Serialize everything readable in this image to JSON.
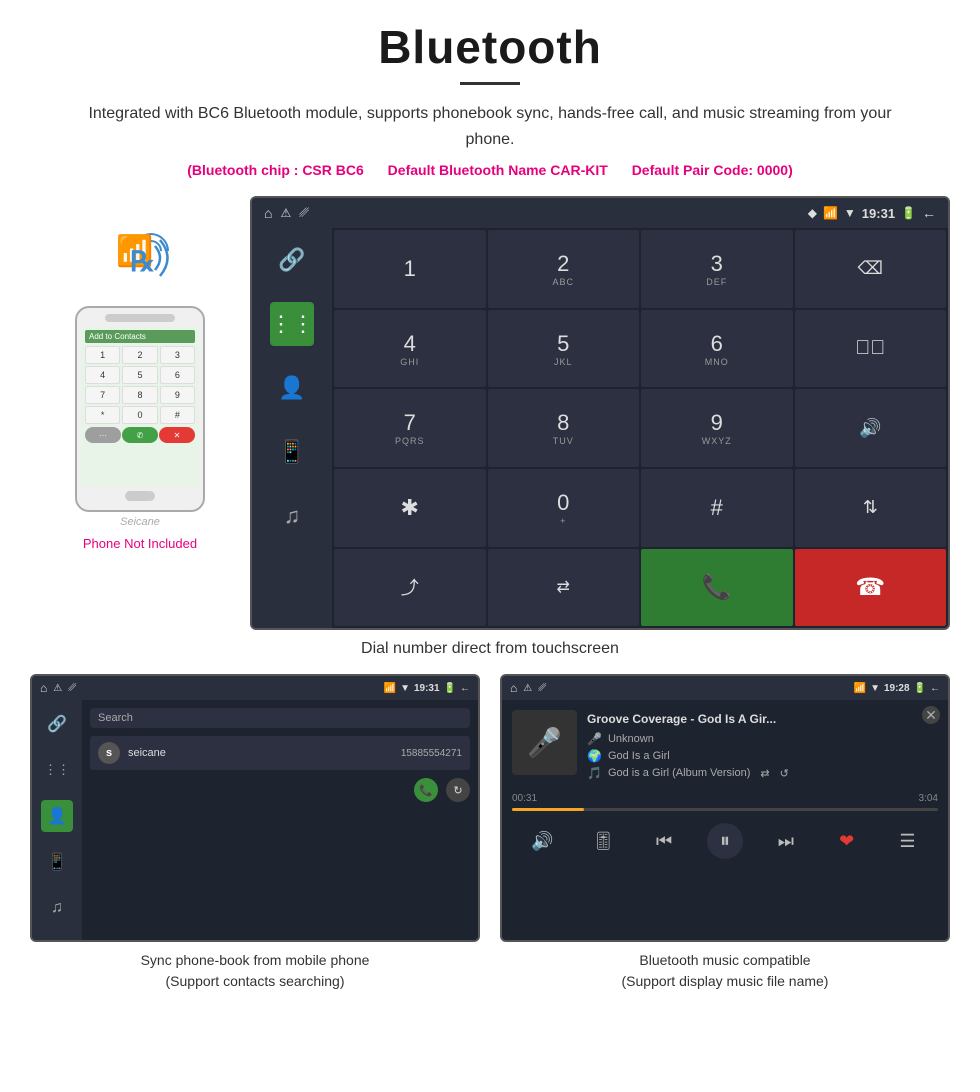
{
  "header": {
    "title": "Bluetooth",
    "description": "Integrated with BC6 Bluetooth module, supports phonebook sync, hands-free call, and music streaming from your phone.",
    "spec_chip": "(Bluetooth chip : CSR BC6",
    "spec_name": "Default Bluetooth Name CAR-KIT",
    "spec_pair": "Default Pair Code: 0000)"
  },
  "phone_illustration": {
    "label": "Seicane",
    "not_included": "Phone Not Included",
    "screen_header": "Add to Contacts",
    "keys": [
      "1",
      "2",
      "3",
      "4",
      "5",
      "6",
      "7",
      "8",
      "9",
      "*",
      "0",
      "#"
    ],
    "btn_red": "✕",
    "btn_green": "✆",
    "btn_grey": "···"
  },
  "car_screen": {
    "status_time": "19:31",
    "status_icons": [
      "⌂",
      "⚠",
      "↨",
      "◈",
      "✦",
      "▶",
      "🔋",
      "←"
    ]
  },
  "dialer": {
    "keys": [
      {
        "main": "1",
        "sub": ""
      },
      {
        "main": "2",
        "sub": "ABC"
      },
      {
        "main": "3",
        "sub": "DEF"
      },
      {
        "main": "⌫",
        "sub": "",
        "special": "backspace"
      },
      {
        "main": "4",
        "sub": "GHI"
      },
      {
        "main": "5",
        "sub": "JKL"
      },
      {
        "main": "6",
        "sub": "MNO"
      },
      {
        "main": "🎤",
        "sub": "",
        "special": "mute"
      },
      {
        "main": "7",
        "sub": "PQRS"
      },
      {
        "main": "8",
        "sub": "TUV"
      },
      {
        "main": "9",
        "sub": "WXYZ"
      },
      {
        "main": "🔊",
        "sub": "",
        "special": "volume"
      },
      {
        "main": "✱",
        "sub": ""
      },
      {
        "main": "0",
        "sub": "+"
      },
      {
        "main": "#",
        "sub": ""
      },
      {
        "main": "⇅",
        "sub": "",
        "special": "transfer"
      },
      {
        "main": "⤊",
        "sub": "",
        "special": "merge"
      },
      {
        "main": "⇄",
        "sub": "",
        "special": "hold"
      },
      {
        "main": "✆",
        "sub": "",
        "special": "call"
      },
      {
        "main": "📵",
        "sub": "",
        "special": "end"
      }
    ],
    "caption": "Dial number direct from touchscreen"
  },
  "contacts_screen": {
    "status_time": "19:31",
    "search_placeholder": "Search",
    "contact": {
      "initial": "s",
      "name": "seicane",
      "phone": "15885554271"
    },
    "caption_line1": "Sync phone-book from mobile phone",
    "caption_line2": "(Support contacts searching)"
  },
  "music_screen": {
    "status_time": "19:28",
    "song_title": "Groove Coverage - God Is A Gir...",
    "artist": "Unknown",
    "album": "God Is a Girl",
    "track": "God is a Girl (Album Version)",
    "time_current": "00:31",
    "time_total": "3:04",
    "progress_pct": 17,
    "caption_line1": "Bluetooth music compatible",
    "caption_line2": "(Support display music file name)"
  },
  "sidebar_icons": {
    "link": "🔗",
    "keypad": "⌨",
    "person": "👤",
    "phone_transfer": "📞",
    "music": "♪"
  }
}
